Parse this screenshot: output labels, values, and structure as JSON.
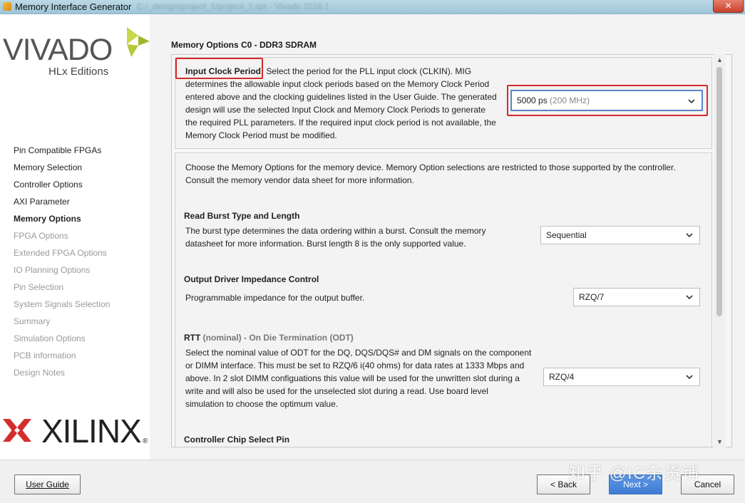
{
  "window": {
    "title": "Memory Interface Generator",
    "title_blurred": "C:/_design/project_1/project_1.xpr - Vivado 2016.1",
    "close_label": "✕"
  },
  "logo": {
    "product": "VIVADO",
    "edition": "HLx Editions",
    "vendor": "XILINX",
    "reg": "®"
  },
  "steps": [
    {
      "label": "Pin Compatible FPGAs",
      "state": "done"
    },
    {
      "label": "Memory Selection",
      "state": "done"
    },
    {
      "label": "Controller Options",
      "state": "done"
    },
    {
      "label": "AXI Parameter",
      "state": "done"
    },
    {
      "label": "Memory Options",
      "state": "active"
    },
    {
      "label": "FPGA Options",
      "state": "disabled"
    },
    {
      "label": "Extended FPGA Options",
      "state": "disabled"
    },
    {
      "label": "IO Planning Options",
      "state": "disabled"
    },
    {
      "label": "Pin Selection",
      "state": "disabled"
    },
    {
      "label": "System Signals Selection",
      "state": "disabled"
    },
    {
      "label": "Summary",
      "state": "disabled"
    },
    {
      "label": "Simulation Options",
      "state": "disabled"
    },
    {
      "label": "PCB information",
      "state": "disabled"
    },
    {
      "label": "Design Notes",
      "state": "disabled"
    }
  ],
  "main": {
    "section_title": "Memory Options C0 - DDR3 SDRAM",
    "input_clock": {
      "label": "Input Clock Period:",
      "lines": [
        "Select the period for the PLL input clock (CLKIN). MIG",
        "determines the allowable input clock periods based on the Memory Clock Period",
        "entered above and the clocking guidelines listed in the User Guide. The generated",
        "design will use the selected Input Clock and Memory Clock Periods to generate",
        "the required PLL parameters. If the required input clock period is not available, the",
        "Memory Clock Period must be modified."
      ],
      "value": "5000 ps",
      "value_sub": "(200 MHz)"
    },
    "intro_lines": [
      "Choose the Memory Options for the memory device. Memory Option selections are restricted to those supported by the controller.",
      "Consult the memory vendor data sheet for more information."
    ],
    "burst": {
      "heading": "Read Burst Type and Length",
      "lines": [
        "The burst type determines the data ordering within a burst. Consult the memory",
        "datasheet for more information. Burst length 8 is the only supported value."
      ],
      "value": "Sequential"
    },
    "odic": {
      "heading": "Output Driver Impedance Control",
      "lines": [
        "Programmable impedance for the output buffer."
      ],
      "value": "RZQ/7"
    },
    "rtt": {
      "heading_main": "RTT",
      "heading_muted": "(nominal)",
      "heading_rest": "- On Die Termination (ODT)",
      "lines": [
        "Select the nominal value of ODT for the DQ, DQS/DQS# and DM signals on the component",
        "or DIMM interface. This must be set to RZQ/6 i(40 ohms) for data rates at 1333 Mbps and",
        "above. In 2 slot DIMM configuations this value will be used for the unwritten slot during a",
        "write and will also be used for the unselected slot during a read. Use board level",
        "simulation to choose the optimum value."
      ],
      "value": "RZQ/4"
    },
    "chip_select": {
      "heading": "Controller Chip Select Pin"
    }
  },
  "footer": {
    "user_guide": "User Guide",
    "back": "< Back",
    "next": "Next >",
    "cancel": "Cancel",
    "watermark": "知乎 @IC杂货铺"
  }
}
